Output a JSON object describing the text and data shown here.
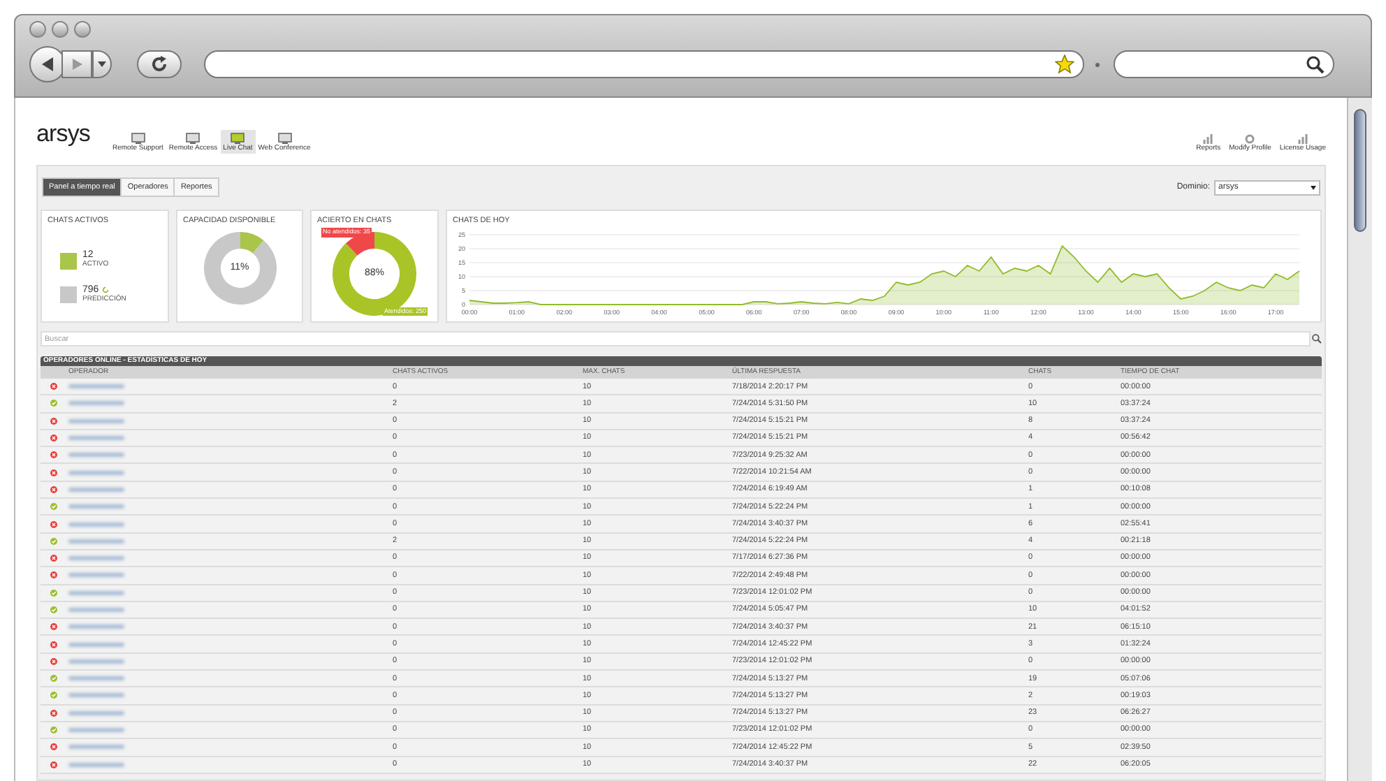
{
  "header": {
    "logo": "arsys",
    "nav": [
      {
        "label": "Remote Support",
        "selected": false
      },
      {
        "label": "Remote Access",
        "selected": false
      },
      {
        "label": "Live Chat",
        "selected": true
      },
      {
        "label": "Web Conference",
        "selected": false
      }
    ],
    "links": [
      "Reports",
      "Modify Profile",
      "License Usage"
    ]
  },
  "tabs": [
    {
      "label": "Panel a tiempo real",
      "selected": true
    },
    {
      "label": "Operadores",
      "selected": false
    },
    {
      "label": "Reportes",
      "selected": false
    }
  ],
  "domain": {
    "label": "Dominio:",
    "value": "arsys"
  },
  "cards": {
    "active": {
      "title": "CHATS ACTIVOS",
      "active_value": "12",
      "active_label": "ACTIVO",
      "prediction_value": "796",
      "prediction_label": "PREDICCIÓN"
    },
    "capacity": {
      "title": "CAPACIDAD DISPONIBLE",
      "reading": "11%"
    },
    "success": {
      "title": "ACIERTO EN CHATS",
      "reading": "88%",
      "missed_label": "No atendidos: 35",
      "served_label": "Atendidos: 250"
    },
    "today": {
      "title": "CHATS DE HOY",
      "chart_data": {
        "type": "area",
        "grid": true,
        "xlim": [
          0,
          17.5
        ],
        "ylim": [
          0,
          25
        ],
        "yticks": [
          0,
          5,
          10,
          15,
          20,
          25
        ],
        "xticks": [
          {
            "value": 0,
            "label": "00:00"
          },
          {
            "value": 1,
            "label": "01:00"
          },
          {
            "value": 2,
            "label": "02:00"
          },
          {
            "value": 3,
            "label": "03:00"
          },
          {
            "value": 4,
            "label": "04:00"
          },
          {
            "value": 5,
            "label": "05:00"
          },
          {
            "value": 6,
            "label": "06:00"
          },
          {
            "value": 7,
            "label": "07:00"
          },
          {
            "value": 8,
            "label": "08:00"
          },
          {
            "value": 9,
            "label": "09:00"
          },
          {
            "value": 10,
            "label": "10:00"
          },
          {
            "value": 11,
            "label": "11:00"
          },
          {
            "value": 12,
            "label": "12:00"
          },
          {
            "value": 13,
            "label": "13:00"
          },
          {
            "value": 14,
            "label": "14:00"
          },
          {
            "value": 15,
            "label": "15:00"
          },
          {
            "value": 16,
            "label": "16:00"
          },
          {
            "value": 17,
            "label": "17:00"
          }
        ],
        "x": [
          0,
          0.25,
          0.5,
          0.75,
          1,
          1.25,
          1.5,
          1.75,
          2,
          2.25,
          2.5,
          2.75,
          3,
          3.25,
          3.5,
          3.75,
          4,
          4.25,
          4.5,
          4.75,
          5,
          5.25,
          5.5,
          5.75,
          6,
          6.25,
          6.5,
          6.75,
          7,
          7.25,
          7.5,
          7.75,
          8,
          8.25,
          8.5,
          8.75,
          9,
          9.25,
          9.5,
          9.75,
          10,
          10.25,
          10.5,
          10.75,
          11,
          11.25,
          11.5,
          11.75,
          12,
          12.25,
          12.5,
          12.75,
          13,
          13.25,
          13.5,
          13.75,
          14,
          14.25,
          14.5,
          14.75,
          15,
          15.25,
          15.5,
          15.75,
          16,
          16.25,
          16.5,
          16.75,
          17,
          17.25,
          17.5
        ],
        "series": [
          {
            "color": "#8fbc2b",
            "values": [
              1.5,
              1,
              0.5,
              0.5,
              0.7,
              1,
              0,
              0,
              0,
              0,
              0,
              0,
              0,
              0,
              0,
              0,
              0,
              0,
              0,
              0,
              0,
              0,
              0,
              0,
              1,
              1,
              0.3,
              0.5,
              1,
              0.5,
              0.3,
              0.8,
              0.3,
              2,
              1.5,
              3,
              8,
              7,
              8,
              11,
              12,
              10,
              14,
              12,
              17,
              11,
              13,
              12,
              14,
              11,
              21,
              17,
              12,
              8,
              13,
              8,
              11,
              10,
              11,
              6,
              2,
              3,
              5,
              8,
              6,
              5,
              7,
              6,
              11,
              9,
              12
            ]
          }
        ]
      }
    }
  },
  "search": {
    "placeholder": "Buscar"
  },
  "table": {
    "title": "OPERADORES ONLINE - ESTADÍSTICAS DE HOY",
    "columns": [
      "OPERADOR",
      "CHATS ACTIVOS",
      "MAX. CHATS",
      "ÚLTIMA RESPUESTA",
      "CHATS",
      "TIEMPO DE CHAT"
    ],
    "rows": [
      {
        "online": false,
        "cells": [
          "",
          "0",
          "10",
          "7/18/2014 2:20:17 PM",
          "0",
          "00:00:00"
        ]
      },
      {
        "online": true,
        "cells": [
          "",
          "2",
          "10",
          "7/24/2014 5:31:50 PM",
          "10",
          "03:37:24"
        ]
      },
      {
        "online": false,
        "cells": [
          "",
          "0",
          "10",
          "7/24/2014 5:15:21 PM",
          "8",
          "03:37:24"
        ]
      },
      {
        "online": false,
        "cells": [
          "",
          "0",
          "10",
          "7/24/2014 5:15:21 PM",
          "4",
          "00:56:42"
        ]
      },
      {
        "online": false,
        "cells": [
          "",
          "0",
          "10",
          "7/23/2014 9:25:32 AM",
          "0",
          "00:00:00"
        ]
      },
      {
        "online": false,
        "cells": [
          "",
          "0",
          "10",
          "7/22/2014 10:21:54 AM",
          "0",
          "00:00:00"
        ]
      },
      {
        "online": false,
        "cells": [
          "",
          "0",
          "10",
          "7/24/2014 6:19:49 AM",
          "1",
          "00:10:08"
        ]
      },
      {
        "online": true,
        "cells": [
          "",
          "0",
          "10",
          "7/24/2014 5:22:24 PM",
          "1",
          "00:00:00"
        ]
      },
      {
        "online": false,
        "cells": [
          "",
          "0",
          "10",
          "7/24/2014 3:40:37 PM",
          "6",
          "02:55:41"
        ]
      },
      {
        "online": true,
        "cells": [
          "",
          "2",
          "10",
          "7/24/2014 5:22:24 PM",
          "4",
          "00:21:18"
        ]
      },
      {
        "online": false,
        "cells": [
          "",
          "0",
          "10",
          "7/17/2014 6:27:36 PM",
          "0",
          "00:00:00"
        ]
      },
      {
        "online": false,
        "cells": [
          "",
          "0",
          "10",
          "7/22/2014 2:49:48 PM",
          "0",
          "00:00:00"
        ]
      },
      {
        "online": true,
        "cells": [
          "",
          "0",
          "10",
          "7/23/2014 12:01:02 PM",
          "0",
          "00:00:00"
        ]
      },
      {
        "online": true,
        "cells": [
          "",
          "0",
          "10",
          "7/24/2014 5:05:47 PM",
          "10",
          "04:01:52"
        ]
      },
      {
        "online": false,
        "cells": [
          "",
          "0",
          "10",
          "7/24/2014 3:40:37 PM",
          "21",
          "06:15:10"
        ]
      },
      {
        "online": false,
        "cells": [
          "",
          "0",
          "10",
          "7/24/2014 12:45:22 PM",
          "3",
          "01:32:24"
        ]
      },
      {
        "online": false,
        "cells": [
          "",
          "0",
          "10",
          "7/23/2014 12:01:02 PM",
          "0",
          "00:00:00"
        ]
      },
      {
        "online": true,
        "cells": [
          "",
          "0",
          "10",
          "7/24/2014 5:13:27 PM",
          "19",
          "05:07:06"
        ]
      },
      {
        "online": true,
        "cells": [
          "",
          "0",
          "10",
          "7/24/2014 5:13:27 PM",
          "2",
          "00:19:03"
        ]
      },
      {
        "online": false,
        "cells": [
          "",
          "0",
          "10",
          "7/24/2014 5:13:27 PM",
          "23",
          "06:26:27"
        ]
      },
      {
        "online": true,
        "cells": [
          "",
          "0",
          "10",
          "7/23/2014 12:01:02 PM",
          "0",
          "00:00:00"
        ]
      },
      {
        "online": false,
        "cells": [
          "",
          "0",
          "10",
          "7/24/2014 12:45:22 PM",
          "5",
          "02:39:50"
        ]
      },
      {
        "online": false,
        "cells": [
          "",
          "0",
          "10",
          "7/24/2014 3:40:37 PM",
          "22",
          "06:20:05"
        ]
      }
    ]
  }
}
